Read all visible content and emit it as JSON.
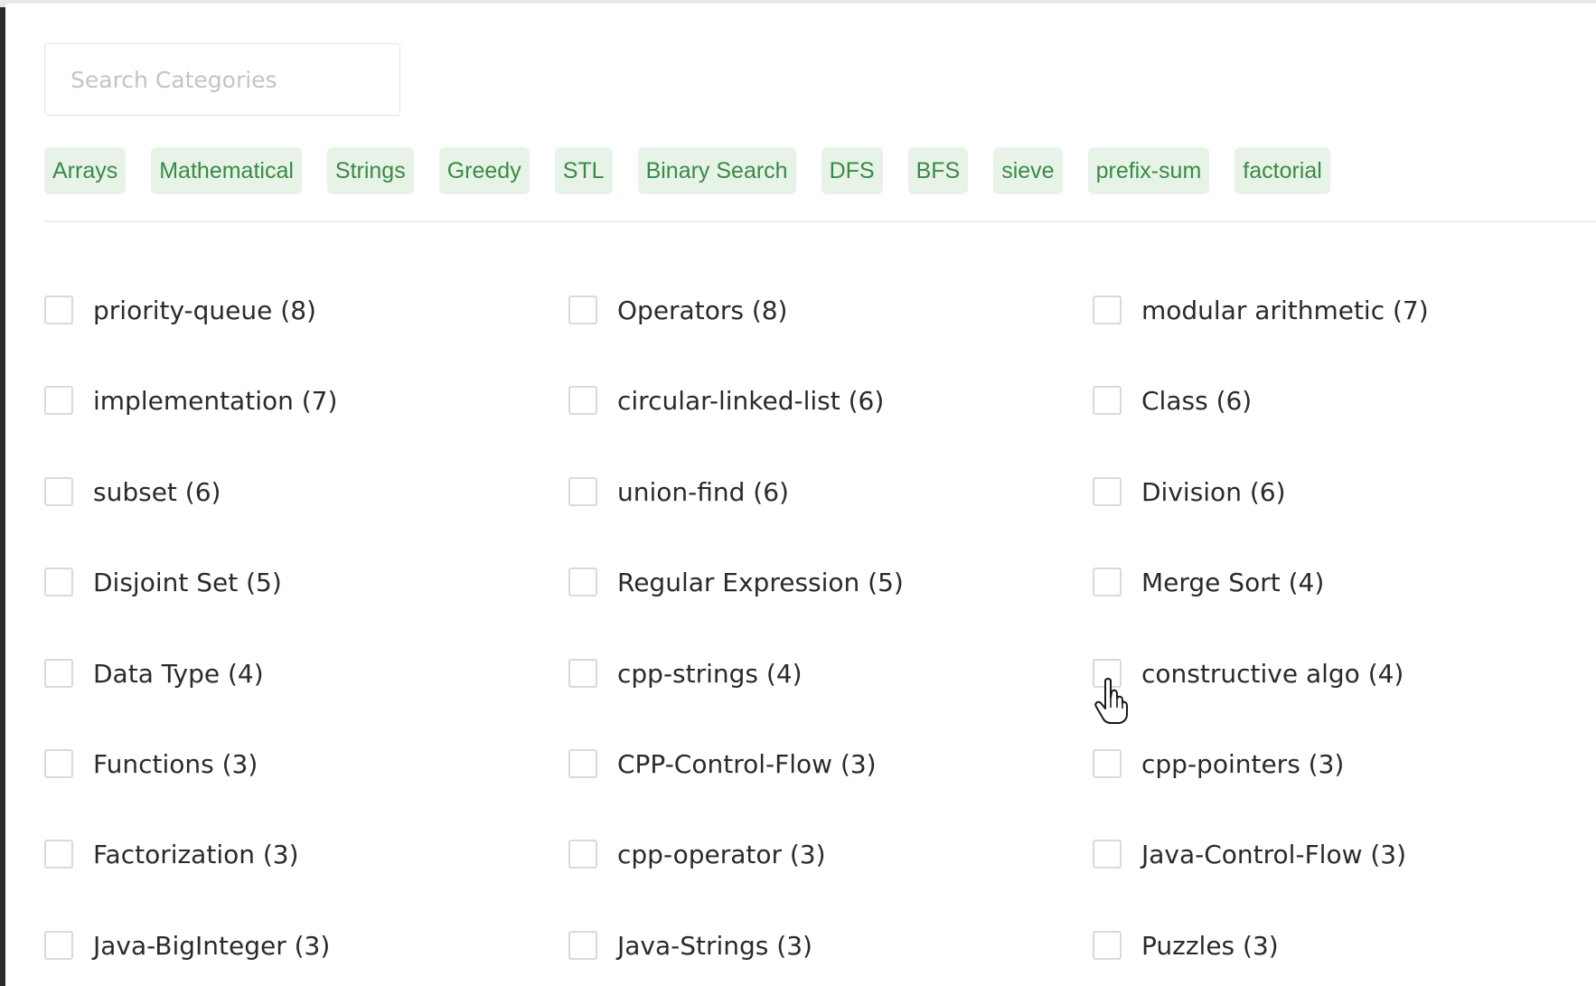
{
  "search": {
    "placeholder": "Search Categories",
    "value": ""
  },
  "tags": [
    "Arrays",
    "Mathematical",
    "Strings",
    "Greedy",
    "STL",
    "Binary Search",
    "DFS",
    "BFS",
    "sieve",
    "prefix-sum",
    "factorial"
  ],
  "categories": [
    "priority-queue (8)",
    "Operators (8)",
    "modular arithmetic (7)",
    "implementation (7)",
    "circular-linked-list (6)",
    "Class (6)",
    "subset (6)",
    "union-find (6)",
    "Division (6)",
    "Disjoint Set (5)",
    "Regular Expression (5)",
    "Merge Sort (4)",
    "Data Type (4)",
    "cpp-strings (4)",
    "constructive algo (4)",
    "Functions (3)",
    "CPP-Control-Flow (3)",
    "cpp-pointers (3)",
    "Factorization (3)",
    "cpp-operator (3)",
    "Java-Control-Flow (3)",
    "Java-BigInteger (3)",
    "Java-Strings (3)",
    "Puzzles (3)"
  ],
  "colors": {
    "tag_bg": "#e8f3e8",
    "tag_text": "#3a8a45",
    "checkbox_border": "#d9d9d9"
  },
  "icons": {
    "cursor": "hand-pointer-icon"
  }
}
